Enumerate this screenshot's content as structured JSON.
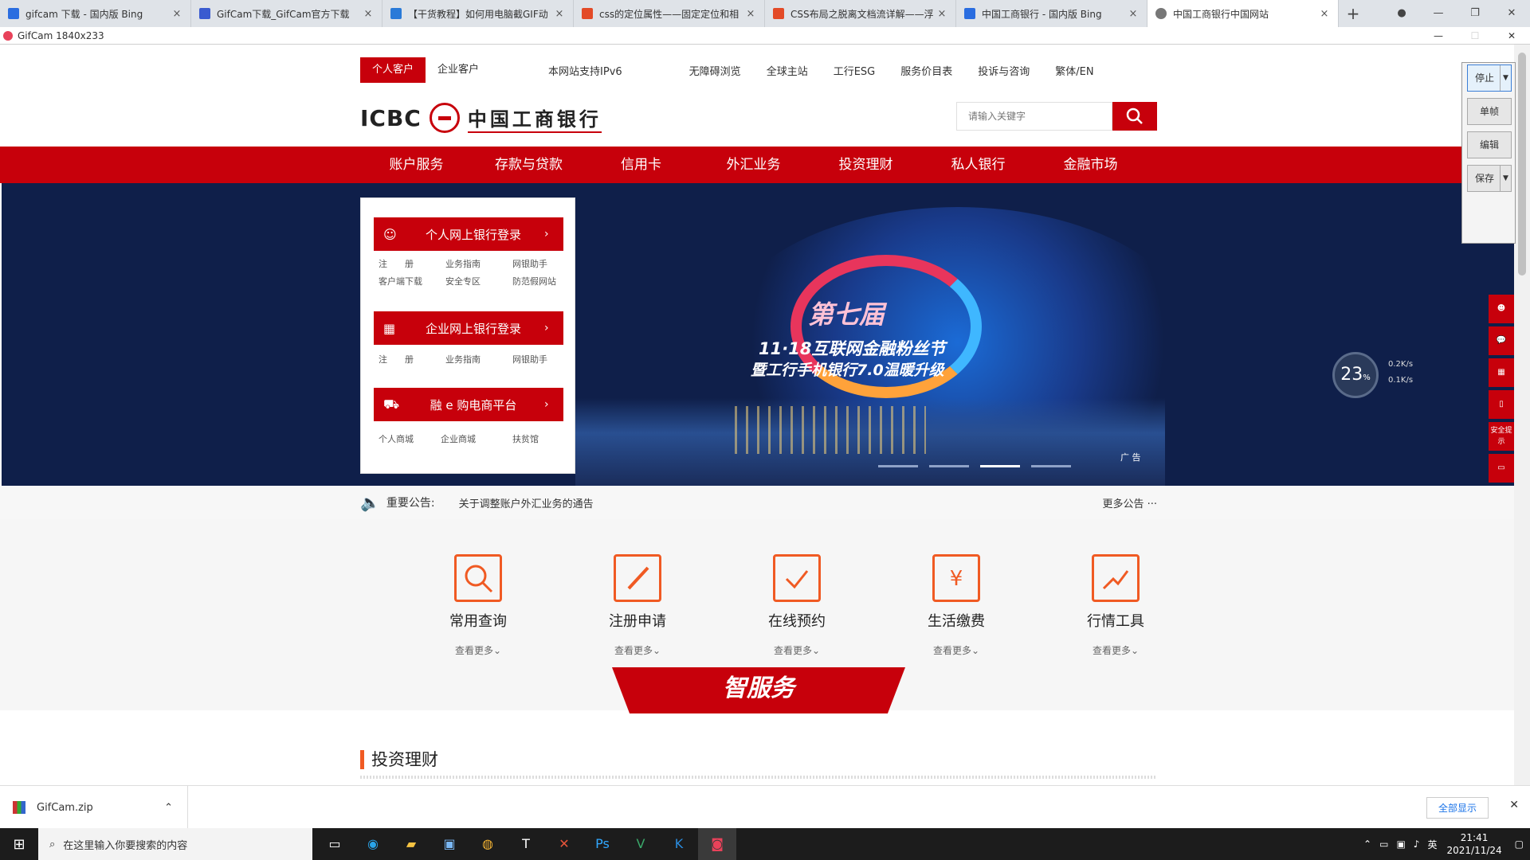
{
  "browser": {
    "tabs": [
      {
        "title": "gifcam 下载 - 国内版 Bing",
        "color": "#2a6de0"
      },
      {
        "title": "GifCam下载_GifCam官方下载",
        "color": "#3a5bd0"
      },
      {
        "title": "【干货教程】如何用电脑截GIF动",
        "color": "#2a7ad8"
      },
      {
        "title": "css的定位属性——固定定位和相",
        "color": "#e34a27"
      },
      {
        "title": "CSS布局之脱离文档流详解——浮",
        "color": "#e34a27"
      },
      {
        "title": "中国工商银行 - 国内版 Bing",
        "color": "#2a6de0"
      },
      {
        "title": "中国工商银行中国网站",
        "color": "#777777"
      }
    ],
    "new_tab": "+",
    "close": "×"
  },
  "gifcam": {
    "title": "GifCam 1840x233",
    "buttons": {
      "stop": "停止",
      "frame": "单帧",
      "edit": "编辑",
      "save": "保存"
    }
  },
  "icbc": {
    "customer_tabs": [
      "个人客户",
      "企业客户"
    ],
    "top_links": [
      "本网站支持IPv6",
      "无障碍浏览",
      "全球主站",
      "工行ESG",
      "服务价目表",
      "投诉与咨询",
      "繁体/EN"
    ],
    "logo": {
      "en": "ICBC",
      "cn": "中国工商银行"
    },
    "search": {
      "placeholder": "请输入关键字"
    },
    "main_nav": [
      "账户服务",
      "存款与贷款",
      "信用卡",
      "外汇业务",
      "投资理财",
      "私人银行",
      "金融市场"
    ],
    "login": {
      "personal": "个人网上银行登录",
      "personal_links": [
        "注　　册",
        "业务指南",
        "网银助手",
        "客户端下载",
        "安全专区",
        "防范假网站"
      ],
      "corporate": "企业网上银行登录",
      "corporate_links": [
        "注　　册",
        "业务指南",
        "网银助手"
      ],
      "shop": "融 e 购电商平台",
      "shop_links": [
        "个人商城",
        "企业商城",
        "扶贫馆"
      ]
    },
    "banner": {
      "title": "第七届",
      "sub1": "11·18互联网金融粉丝节",
      "sub2": "暨工行手机银行7.0温暖升级",
      "ad": "广 告"
    },
    "notice": {
      "label": "重要公告:",
      "text": "关于调整账户外汇业务的通告",
      "more": "更多公告"
    },
    "services": [
      {
        "name": "常用查询",
        "more": "查看更多"
      },
      {
        "name": "注册申请",
        "more": "查看更多"
      },
      {
        "name": "在线预约",
        "more": "查看更多"
      },
      {
        "name": "生活缴费",
        "more": "查看更多"
      },
      {
        "name": "行情工具",
        "more": "查看更多"
      }
    ],
    "smart_service": "智服务",
    "invest_title": "投资理财",
    "side_tools": [
      "",
      "",
      "",
      "",
      "安全提示",
      ""
    ],
    "speed": {
      "value": "23",
      "unit": "%",
      "up": "0.2K/s",
      "down": "0.1K/s"
    }
  },
  "downloads": {
    "file": "GifCam.zip",
    "show_all": "全部显示"
  },
  "taskbar": {
    "search_placeholder": "在这里输入你要搜索的内容",
    "time": "21:41",
    "date": "2021/11/24",
    "ime": "英"
  },
  "colors": {
    "brand_red": "#c7000b",
    "accent_orange": "#f05a23",
    "banner_navy": "#0f1f4a"
  }
}
